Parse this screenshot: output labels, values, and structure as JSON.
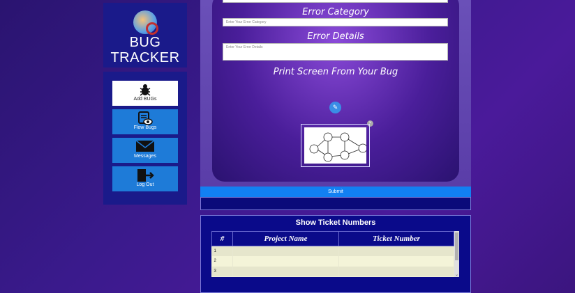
{
  "brand": {
    "line1": "BUG",
    "line2": "TRACKER"
  },
  "menu": [
    {
      "label": "Add BUGs",
      "icon": "bug-icon"
    },
    {
      "label": "Flow Bugs",
      "icon": "document-eye-icon"
    },
    {
      "label": "Messages",
      "icon": "envelope-icon"
    },
    {
      "label": "Log Out",
      "icon": "logout-icon"
    }
  ],
  "form": {
    "category_label": "Error Category",
    "category_placeholder": "Enter Your Error Category",
    "details_label": "Error Details",
    "details_placeholder": "Enter Your Error Details",
    "screenshot_label": "Print Screen From Your Bug",
    "submit_label": "Submit"
  },
  "tickets": {
    "title": "Show Ticket Numbers",
    "columns": [
      "#",
      "Project Name",
      "Ticket Number"
    ],
    "rows": [
      {
        "num": "1",
        "project": "",
        "ticket": ""
      },
      {
        "num": "2",
        "project": "",
        "ticket": ""
      },
      {
        "num": "3",
        "project": "",
        "ticket": ""
      }
    ]
  },
  "colors": {
    "sidebar": "#1a1a8a",
    "accent": "#1e7bd8",
    "submit": "#1280f2"
  }
}
